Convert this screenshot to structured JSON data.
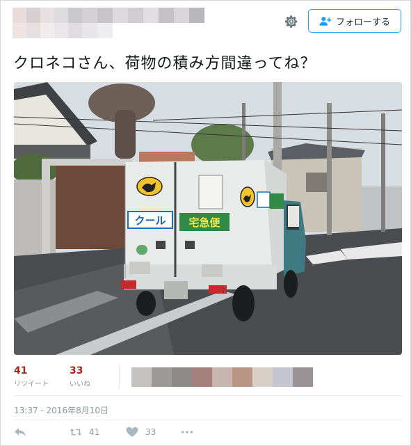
{
  "header": {
    "follow_label": "フォローする",
    "settings_icon": "gear-icon",
    "follow_icon": "add-user-icon"
  },
  "tweet": {
    "text": "クロネコさん、荷物の積み方間違ってね？",
    "photo_signs": {
      "cool": "クール",
      "takkyubin": "宅急便"
    }
  },
  "stats": {
    "retweets_count": "41",
    "retweets_label": "リツイート",
    "likes_count": "33",
    "likes_label": "いいね"
  },
  "timestamp": "13:37 - 2016年8月10日",
  "actions": {
    "reply_icon": "reply-icon",
    "retweet_icon": "retweet-icon",
    "retweet_count": "41",
    "like_icon": "heart-icon",
    "like_count": "33",
    "more_icon": "more-icon"
  },
  "colors": {
    "accent": "#1da1f2",
    "stat_number": "#a0291d",
    "muted": "#8899a6"
  }
}
